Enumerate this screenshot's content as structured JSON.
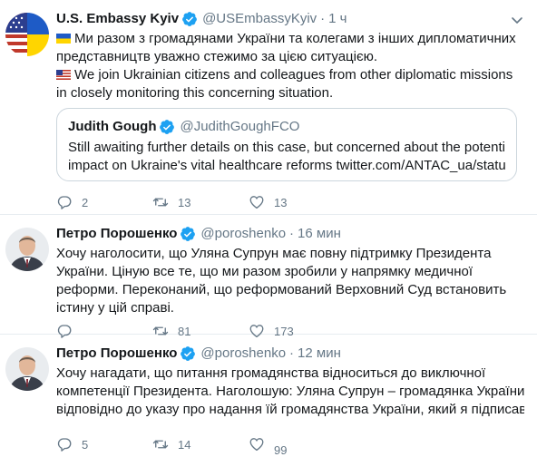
{
  "tweets": [
    {
      "name": "U.S. Embassy Kyiv",
      "handle": "@USEmbassyKyiv",
      "time": "1 ч",
      "lines": [
        "Ми разом з громадянами України та колегами з інших дипломатичних",
        "представництв уважно стежимо за цією ситуацією.",
        "We join Ukrainian citizens and colleagues from other diplomatic missions",
        "in closely monitoring this concerning situation."
      ],
      "quote": {
        "name": "Judith Gough",
        "handle": "@JudithGoughFCO",
        "lines": [
          "Still awaiting further details on this case, but concerned about the potential",
          "impact on Ukraine's vital healthcare reforms twitter.com/ANTAC_ua/statu..."
        ]
      },
      "replies": "2",
      "retweets": "13",
      "likes": "13"
    },
    {
      "name": "Петро Порошенко",
      "handle": "@poroshenko",
      "time": "16 мин",
      "lines": [
        "Хочу наголосити, що Уляна Супрун має повну підтримку Президента",
        "України. Ціную все те, що ми разом зробили у напрямку медичної",
        "реформи. Переконаний, що реформований Верховний Суд встановить",
        "істину у цій справі."
      ],
      "replies": "",
      "retweets": "81",
      "likes": "173"
    },
    {
      "name": "Петро Порошенко",
      "handle": "@poroshenko",
      "time": "12 мин",
      "lines": [
        "Хочу нагадати, що питання громадянства відноситься до виключної",
        "компетенції Президента. Наголошую: Уляна Супрун – громадянка України",
        "відповідно до указу про надання їй громадянства України, який я підписав"
      ],
      "replies": "5",
      "retweets": "14",
      "likes": "99"
    }
  ],
  "colors": {
    "verified": "#1da1f2",
    "muted": "#657786",
    "border": "#e6ecf0",
    "retweet_active": "#657786"
  },
  "icons": [
    "verified-badge-icon",
    "chevron-down-icon",
    "reply-icon",
    "retweet-icon",
    "like-icon",
    "flag-ukraine-icon",
    "flag-usa-icon"
  ]
}
